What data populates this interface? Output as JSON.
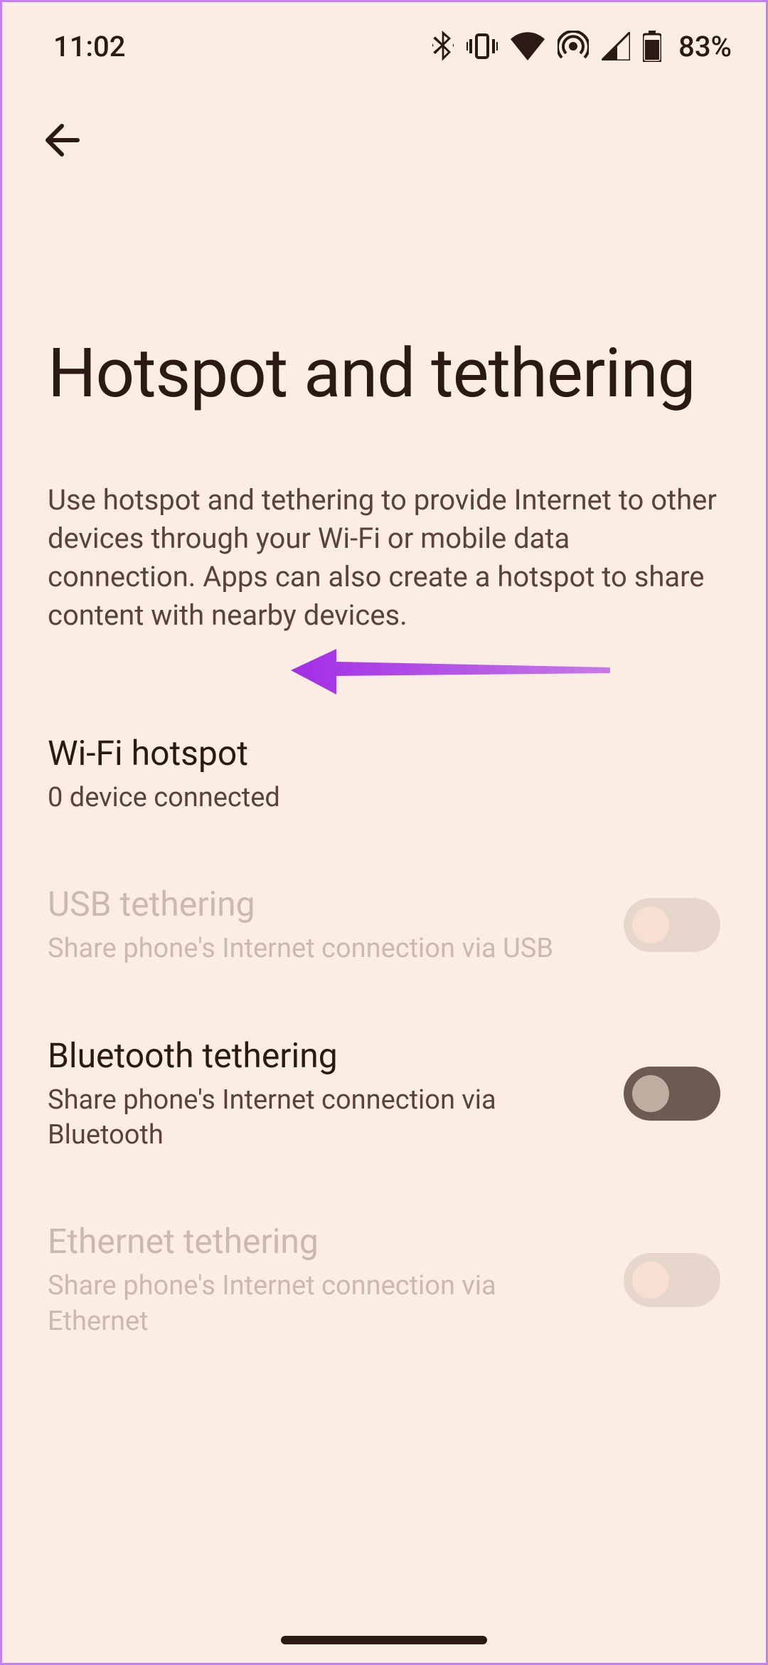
{
  "status": {
    "time": "11:02",
    "battery_pct": "83%"
  },
  "page": {
    "title": "Hotspot and tethering",
    "description": "Use hotspot and tethering to provide Internet to other devices through your Wi-Fi or mobile data connection. Apps can also create a hotspot to share content with nearby devices."
  },
  "settings": [
    {
      "title": "Wi-Fi hotspot",
      "subtitle": "0 device connected",
      "has_switch": false,
      "enabled": true
    },
    {
      "title": "USB tethering",
      "subtitle": "Share phone's Internet connection via USB",
      "has_switch": true,
      "switch_on": false,
      "enabled": false
    },
    {
      "title": "Bluetooth tethering",
      "subtitle": "Share phone's Internet connection via Bluetooth",
      "has_switch": true,
      "switch_on": false,
      "enabled": true
    },
    {
      "title": "Ethernet tethering",
      "subtitle": "Share phone's Internet connection via Ethernet",
      "has_switch": true,
      "switch_on": false,
      "enabled": false
    }
  ],
  "annotation": {
    "arrow_color": "#a22ee6"
  }
}
